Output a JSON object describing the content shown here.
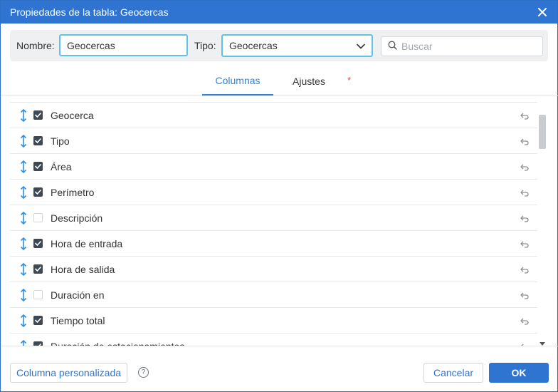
{
  "window": {
    "title": "Propiedades de la tabla: Geocercas"
  },
  "filters": {
    "name_label": "Nombre:",
    "name_value": "Geocercas",
    "type_label": "Tipo:",
    "type_value": "Geocercas",
    "search_placeholder": "Buscar"
  },
  "tabs": [
    {
      "label": "Columnas",
      "active": true
    },
    {
      "label": "Ajustes",
      "active": false
    }
  ],
  "required_marker": "*",
  "rows": [
    {
      "label": "Geocerca",
      "checked": true
    },
    {
      "label": "Tipo",
      "checked": true
    },
    {
      "label": "Área",
      "checked": true
    },
    {
      "label": "Perímetro",
      "checked": true
    },
    {
      "label": "Descripción",
      "checked": false
    },
    {
      "label": "Hora de entrada",
      "checked": true
    },
    {
      "label": "Hora de salida",
      "checked": true
    },
    {
      "label": "Duración en",
      "checked": false
    },
    {
      "label": "Tiempo total",
      "checked": true
    },
    {
      "label": "Duración de estacionamientos",
      "checked": true
    }
  ],
  "footer": {
    "custom_column_label": "Columna personalizada",
    "help_label": "?",
    "cancel_label": "Cancelar",
    "ok_label": "OK"
  },
  "colors": {
    "titlebar": "#2f74d0",
    "accent": "#2f85d8",
    "focus_border": "#5fc3e4",
    "drag_icon": "#2f8fe0",
    "checkbox_checked": "#3d4a56"
  },
  "icons": {
    "close": "close-icon",
    "dropdown": "chevron-down-icon",
    "search": "search-icon",
    "drag": "drag-vertical-icon",
    "undo": "undo-icon",
    "help": "help-circle-icon"
  }
}
